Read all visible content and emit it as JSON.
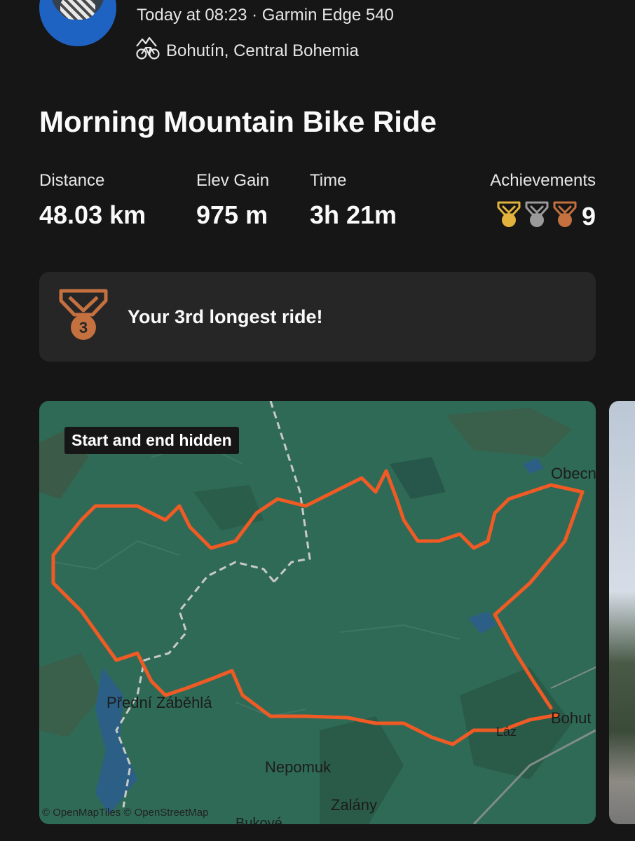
{
  "header": {
    "meta": "Today at 08:23 · Garmin Edge 540",
    "location": "Bohutín, Central Bohemia",
    "location_icon": "mountain-bike-icon"
  },
  "activity": {
    "title": "Morning Mountain Bike Ride"
  },
  "stats": [
    {
      "label": "Distance",
      "value": "48.03 km"
    },
    {
      "label": "Elev Gain",
      "value": "975 m"
    },
    {
      "label": "Time",
      "value": "3h 21m"
    }
  ],
  "achievements": {
    "label": "Achievements",
    "count": "9",
    "medal_colors": [
      "#e3b23c",
      "#9a9a9a",
      "#c4703f"
    ]
  },
  "highlight": {
    "medal_number": "3",
    "text": "Your 3rd longest ride!",
    "medal_color": "#c4703f"
  },
  "map": {
    "privacy_label": "Start and end hidden",
    "places": [
      "Obecn",
      "Přední Záběhlá",
      "Nepomuk",
      "Zalány",
      "Bohut",
      "Láz",
      "Bukové"
    ],
    "attribution": "© OpenMapTiles © OpenStreetMap",
    "route_color": "#f05a24",
    "water_color": "#2b5f86",
    "land_color": "#2f6a56"
  }
}
